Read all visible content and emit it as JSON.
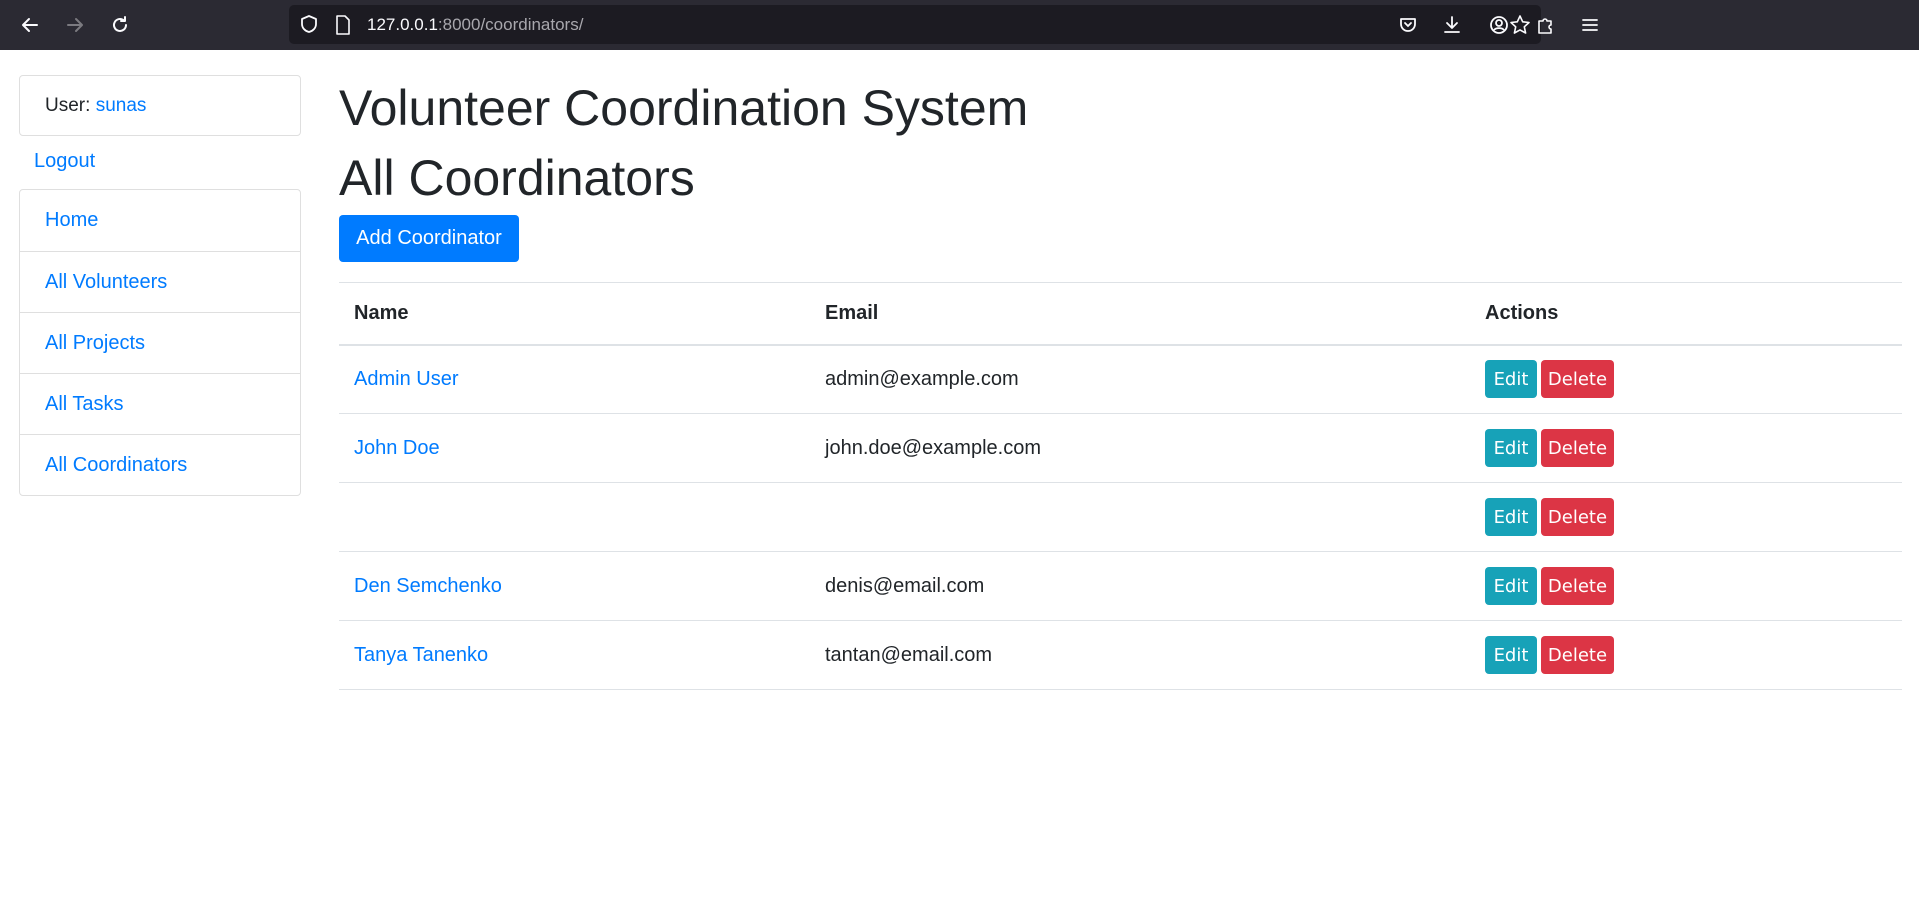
{
  "browser": {
    "url_host": "127.0.0.1",
    "url_path": ":8000/coordinators/"
  },
  "sidebar": {
    "user_label": "User:",
    "username": "sunas",
    "logout": "Logout",
    "items": [
      {
        "label": "Home"
      },
      {
        "label": "All Volunteers"
      },
      {
        "label": "All Projects"
      },
      {
        "label": "All Tasks"
      },
      {
        "label": "All Coordinators"
      }
    ]
  },
  "main": {
    "title": "Volunteer Coordination System",
    "subtitle": "All Coordinators",
    "add_button": "Add Coordinator",
    "table": {
      "headers": [
        "Name",
        "Email",
        "Actions"
      ],
      "edit_label": "Edit",
      "delete_label": "Delete",
      "rows": [
        {
          "name": "Admin User",
          "email": "admin@example.com"
        },
        {
          "name": "John Doe",
          "email": "john.doe@example.com"
        },
        {
          "name": "",
          "email": ""
        },
        {
          "name": "Den Semchenko",
          "email": "denis@email.com"
        },
        {
          "name": "Tanya Tanenko",
          "email": "tantan@email.com"
        }
      ]
    }
  },
  "colors": {
    "primary": "#007bff",
    "info": "#17a2b8",
    "danger": "#dc3545",
    "chrome": "#2b2a33"
  }
}
